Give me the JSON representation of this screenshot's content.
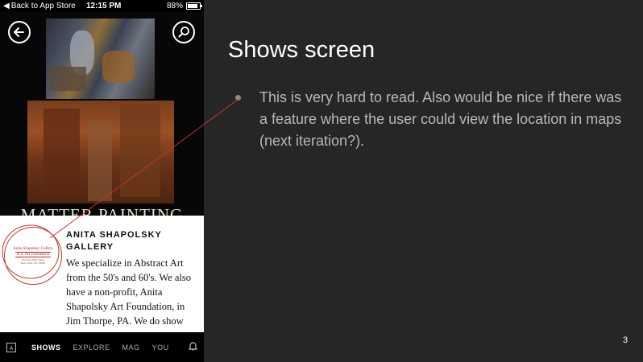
{
  "phone": {
    "status_bar": {
      "back_label": "Back to App Store",
      "time": "12:15 PM",
      "battery": "88%"
    },
    "artwork": {
      "title": "MATTER PAINTING"
    },
    "gallery": {
      "logo": {
        "line1": "Anita Shapolsky Gallery",
        "line2": "A.S. Art Foundation",
        "line3": "152 East 65th Street",
        "line4": "New York, NY 10065"
      },
      "name": "ANITA SHAPOLSKY GALLERY",
      "description": "We specialize in Abstract Art from the 50's and 60's. We also have a non-profit, Anita Shapolsky Art Foundation, in Jim Thorpe, PA. We do show emerging artists in the tradition"
    },
    "nav": {
      "items": [
        "SHOWS",
        "EXPLORE",
        "MAG",
        "YOU"
      ],
      "active": "SHOWS"
    }
  },
  "slide": {
    "title": "Shows screen",
    "bullets": [
      "This is very hard to read. Also would be nice if there was a feature where the user could view the location in maps (next iteration?)."
    ],
    "page_number": "3"
  },
  "colors": {
    "slide_background": "#262626",
    "annotation_red": "#c0392b",
    "bullet_text": "#b8b8b8"
  }
}
